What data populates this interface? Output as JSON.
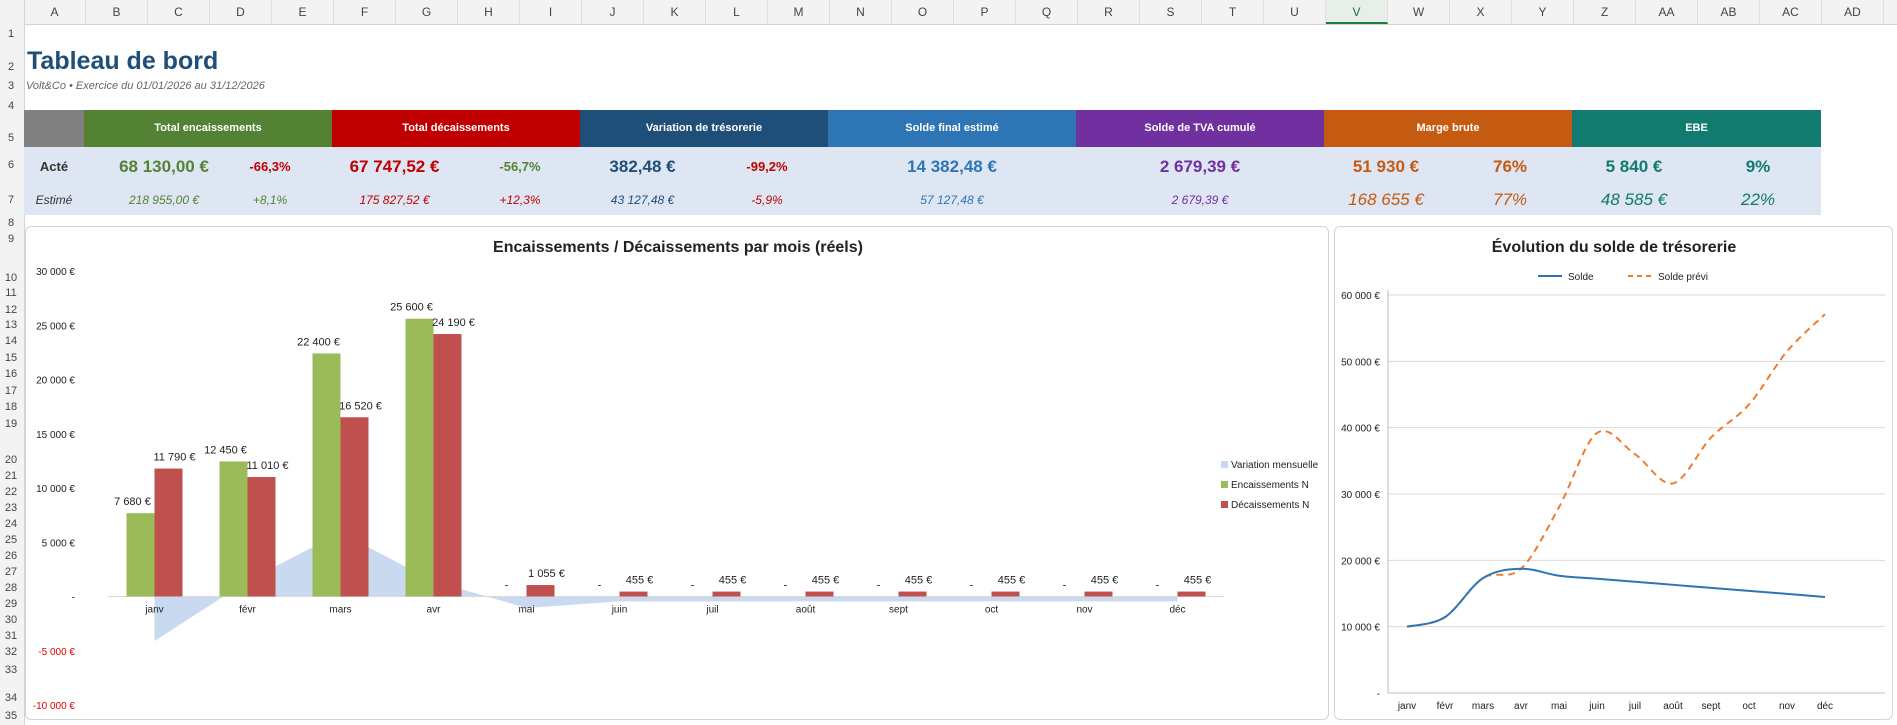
{
  "columns": [
    "A",
    "B",
    "C",
    "D",
    "E",
    "F",
    "G",
    "H",
    "I",
    "J",
    "K",
    "L",
    "M",
    "N",
    "O",
    "P",
    "Q",
    "R",
    "S",
    "T",
    "U",
    "V",
    "W",
    "X",
    "Y",
    "Z",
    "AA",
    "AB",
    "AC",
    "AD"
  ],
  "selected_column": "V",
  "rows": [
    "1",
    "2",
    "3",
    "4",
    "5",
    "6",
    "7",
    "8",
    "9",
    "10",
    "11",
    "12",
    "13",
    "14",
    "15",
    "16",
    "17",
    "18",
    "19",
    "20",
    "21",
    "22",
    "23",
    "24",
    "25",
    "26",
    "27",
    "28",
    "29",
    "30",
    "31",
    "32",
    "33",
    "34",
    "35"
  ],
  "header": {
    "title": "Tableau de bord",
    "subtitle": "Volt&Co  •  Exercice du 01/01/2026 au 31/12/2026"
  },
  "kpi": {
    "row_labels": {
      "actual": "Acté",
      "estimated": "Estimé"
    },
    "cards": [
      {
        "label": "Total encaissements",
        "color": "#548235",
        "actual": "68 130,00 €",
        "actual_pct": "-66,3%",
        "actual_pct_color": "#c00000",
        "estimated": "218 955,00 €",
        "estimated_pct": "+8,1%",
        "estimated_pct_color": "#548235"
      },
      {
        "label": "Total décaissements",
        "color": "#c00000",
        "actual": "67 747,52 €",
        "actual_pct": "-56,7%",
        "actual_pct_color": "#548235",
        "estimated": "175 827,52 €",
        "estimated_pct": "+12,3%",
        "estimated_pct_color": "#c00000"
      },
      {
        "label": "Variation de trésorerie",
        "color": "#1f4e79",
        "actual": "382,48 €",
        "actual_pct": "-99,2%",
        "actual_pct_color": "#c00000",
        "estimated": "43 127,48 €",
        "estimated_pct": "-5,9%",
        "estimated_pct_color": "#c00000"
      },
      {
        "label": "Solde final estimé",
        "color": "#2e75b6",
        "actual": "14 382,48 €",
        "estimated": "57 127,48 €"
      },
      {
        "label": "Solde de TVA cumulé",
        "color": "#7030a0",
        "actual": "2 679,39 €",
        "estimated": "2 679,39 €"
      },
      {
        "label": "Marge brute",
        "color": "#c55a11",
        "actual": "51 930 €",
        "actual_pct": "76%",
        "estimated": "168 655 €",
        "estimated_pct": "77%"
      },
      {
        "label": "EBE",
        "color": "#127a6e",
        "actual": "5 840 €",
        "actual_pct": "9%",
        "estimated": "48 585 €",
        "estimated_pct": "22%"
      }
    ]
  },
  "chart_data": [
    {
      "type": "bar",
      "title": "Encaissements / Décaissements par mois (réels)",
      "categories": [
        "janv",
        "févr",
        "mars",
        "avr",
        "mai",
        "juin",
        "juil",
        "août",
        "sept",
        "oct",
        "nov",
        "déc"
      ],
      "ylim": [
        -10000,
        30000
      ],
      "yticks": [
        "30 000 €",
        "25 000 €",
        "20 000 €",
        "15 000 €",
        "10 000 €",
        "5 000 €",
        "-",
        "-5 000 €",
        "-10 000 €"
      ],
      "ytick_values": [
        30000,
        25000,
        20000,
        15000,
        10000,
        5000,
        0,
        -5000,
        -10000
      ],
      "legend_position": "right",
      "series": [
        {
          "name": "Variation mensuelle",
          "type": "area",
          "color": "#c9d9ef",
          "values": [
            -4110,
            1440,
            5880,
            1410,
            -1055,
            -455,
            -455,
            -455,
            -455,
            -455,
            -455,
            -455
          ]
        },
        {
          "name": "Encaissements N",
          "color": "#9bbb59",
          "values": [
            7680,
            12450,
            22400,
            25600,
            0,
            0,
            0,
            0,
            0,
            0,
            0,
            0
          ],
          "labels": [
            "7 680 €",
            "12 450 €",
            "22 400 €",
            "25 600 €",
            "-",
            "-",
            "-",
            "-",
            "-",
            "-",
            "-",
            "-"
          ]
        },
        {
          "name": "Décaissements N",
          "color": "#c0504d",
          "values": [
            11790,
            11010,
            16520,
            24190,
            1055,
            455,
            455,
            455,
            455,
            455,
            455,
            455
          ],
          "labels": [
            "11 790 €",
            "11 010 €",
            "16 520 €",
            "24 190 €",
            "1 055 €",
            "455 €",
            "455 €",
            "455 €",
            "455 €",
            "455 €",
            "455 €",
            "455 €"
          ]
        }
      ]
    },
    {
      "type": "line",
      "title": "Évolution du solde de trésorerie",
      "categories": [
        "janv",
        "févr",
        "mars",
        "avr",
        "mai",
        "juin",
        "juil",
        "août",
        "sept",
        "oct",
        "nov",
        "déc"
      ],
      "ylim": [
        0,
        60000
      ],
      "yticks": [
        "60 000 €",
        "50 000 €",
        "40 000 €",
        "30 000 €",
        "20 000 €",
        "10 000 €",
        "-"
      ],
      "ytick_values": [
        60000,
        50000,
        40000,
        30000,
        20000,
        10000,
        0
      ],
      "legend_position": "top",
      "series": [
        {
          "name": "Solde",
          "color": "#2e75b6",
          "dashed": false,
          "values": [
            10000,
            11440,
            17320,
            18730,
            17680,
            17220,
            16770,
            16310,
            15850,
            15400,
            14940,
            14480
          ]
        },
        {
          "name": "Solde prévi",
          "color": "#ed7d31",
          "dashed": true,
          "values": [
            10000,
            11440,
            17320,
            18730,
            28000,
            39200,
            36000,
            31600,
            38500,
            43500,
            51500,
            57100
          ]
        }
      ]
    }
  ]
}
